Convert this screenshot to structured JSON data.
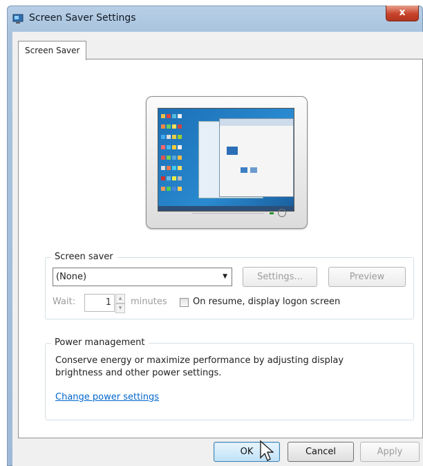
{
  "window": {
    "title": "Screen Saver Settings",
    "close_glyph": "x",
    "icon": "screen-saver-app-icon"
  },
  "tabs": [
    {
      "label": "Screen Saver",
      "selected": true
    }
  ],
  "screen_saver": {
    "group_label": "Screen saver",
    "selected": "(None)",
    "settings_label": "Settings...",
    "preview_label": "Preview",
    "wait_label": "Wait:",
    "wait_value": "1",
    "minutes_label": "minutes",
    "logon_label": "On resume, display logon screen",
    "logon_checked": false
  },
  "power": {
    "group_label": "Power management",
    "description": "Conserve energy or maximize performance by adjusting display brightness and other power settings.",
    "link_label": "Change power settings"
  },
  "buttons": {
    "ok": "OK",
    "cancel": "Cancel",
    "apply": "Apply"
  },
  "colors": {
    "title_bar": "#a9c3de",
    "close_button": "#c8432b",
    "link": "#0066cc",
    "desktop_preview": "#2a8ad0"
  }
}
